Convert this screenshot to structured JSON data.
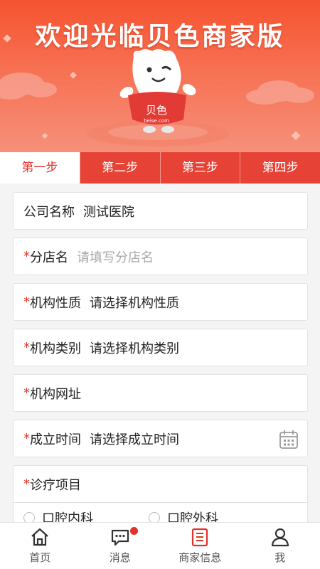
{
  "banner": {
    "title": "欢迎光临贝色商家版",
    "mascot_badge": "贝色",
    "mascot_url": "beise.com"
  },
  "steps": [
    {
      "label": "第一步",
      "active": true
    },
    {
      "label": "第二步",
      "active": false
    },
    {
      "label": "第三步",
      "active": false
    },
    {
      "label": "第四步",
      "active": false
    }
  ],
  "form": {
    "company": {
      "label": "公司名称",
      "value": "测试医院"
    },
    "branch": {
      "label": "分店名",
      "placeholder": "请填写分店名"
    },
    "nature": {
      "label": "机构性质",
      "value": "请选择机构性质"
    },
    "category": {
      "label": "机构类别",
      "value": "请选择机构类别"
    },
    "website": {
      "label": "机构网址",
      "value": ""
    },
    "founded": {
      "label": "成立时间",
      "value": "请选择成立时间",
      "icon": "calendar-icon"
    },
    "projects": {
      "label": "诊疗项目"
    },
    "options": [
      "口腔内科",
      "口腔外科"
    ],
    "required_mark": "*"
  },
  "tabbar": [
    {
      "label": "首页",
      "icon": "home-icon"
    },
    {
      "label": "消息",
      "icon": "message-icon",
      "badge": true
    },
    {
      "label": "商家信息",
      "icon": "list-icon",
      "active": true
    },
    {
      "label": "我",
      "icon": "user-icon"
    }
  ],
  "colors": {
    "accent": "#e0332a",
    "banner": "#f5532f",
    "tab_active_icon": "#e0332a"
  }
}
